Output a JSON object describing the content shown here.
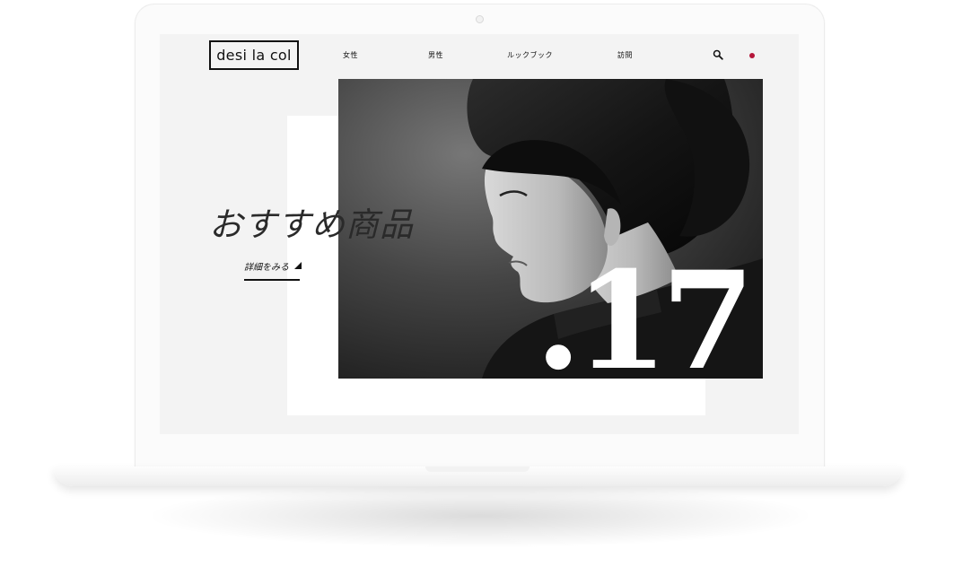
{
  "brand": {
    "logo_text": "desi la col"
  },
  "nav": {
    "items": [
      {
        "label": "女性"
      },
      {
        "label": "男性"
      },
      {
        "label": "ルックブック"
      },
      {
        "label": "訪問"
      }
    ]
  },
  "header": {
    "search_icon": "search-icon",
    "language_indicator_color": "#b5163a"
  },
  "hero": {
    "title": "おすすめ商品",
    "cta_label": "詳細をみる",
    "overlay_number": ".17"
  }
}
